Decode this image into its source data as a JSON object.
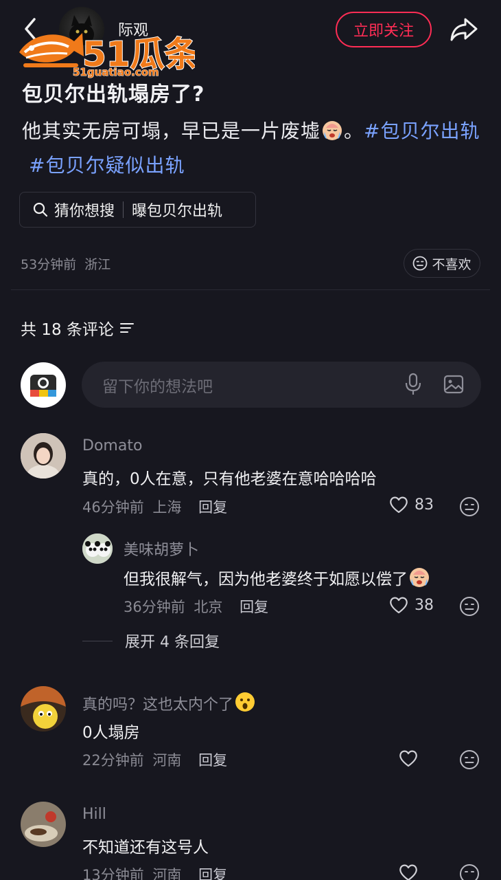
{
  "header": {
    "author": "际观",
    "follow_label": "立即关注"
  },
  "watermark": {
    "brand": "51瓜条",
    "url": "51guatiao.com"
  },
  "post": {
    "title": "包贝尔出轨塌房了?",
    "body_text": "他其实无房可塌，早已是一片废墟",
    "body_after_emoji": "。",
    "tag1": "#包贝尔出轨",
    "tag2": "#包贝尔疑似出轨",
    "search_hint_label": "猜你想搜",
    "search_hint_query": "曝包贝尔出轨",
    "time": "53分钟前",
    "location": "浙江",
    "dislike_label": "不喜欢"
  },
  "comments_header": {
    "count_label": "共 18 条评论"
  },
  "comment_input": {
    "placeholder": "留下你的想法吧"
  },
  "comments": [
    {
      "user": "Domato",
      "text": "真的，0人在意，只有他老婆在意哈哈哈哈",
      "time": "46分钟前",
      "location": "上海",
      "reply_label": "回复",
      "likes": "83"
    },
    {
      "user": "美味胡萝卜",
      "text": "但我很解气，因为他老婆终于如愿以偿了",
      "time": "36分钟前",
      "location": "北京",
      "reply_label": "回复",
      "likes": "38"
    },
    {
      "user": "真的吗？这也太内个了",
      "text": "0人塌房",
      "time": "22分钟前",
      "location": "河南",
      "reply_label": "回复",
      "likes": ""
    },
    {
      "user": "Hill",
      "text": "不知道还有这号人",
      "time": "13分钟前",
      "location": "河南",
      "reply_label": "回复",
      "likes": ""
    }
  ],
  "expand_replies_label": "展开 4 条回复",
  "colors": {
    "background": "#17171f",
    "accent_red": "#ff2d55",
    "tag_blue": "#7aa2ff",
    "watermark_orange": "#f07a1a"
  }
}
